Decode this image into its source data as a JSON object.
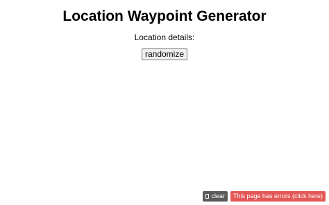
{
  "page": {
    "title": "Location Waypoint Generator",
    "details_label": "Location details:",
    "randomize_label": "randomize"
  },
  "console_bar": {
    "clear_label": "clear",
    "clear_icon": "clear-icon",
    "errors_label": "This page has errors (click here)",
    "errors_color": "#e35757",
    "clear_color": "#5a5a5a"
  }
}
